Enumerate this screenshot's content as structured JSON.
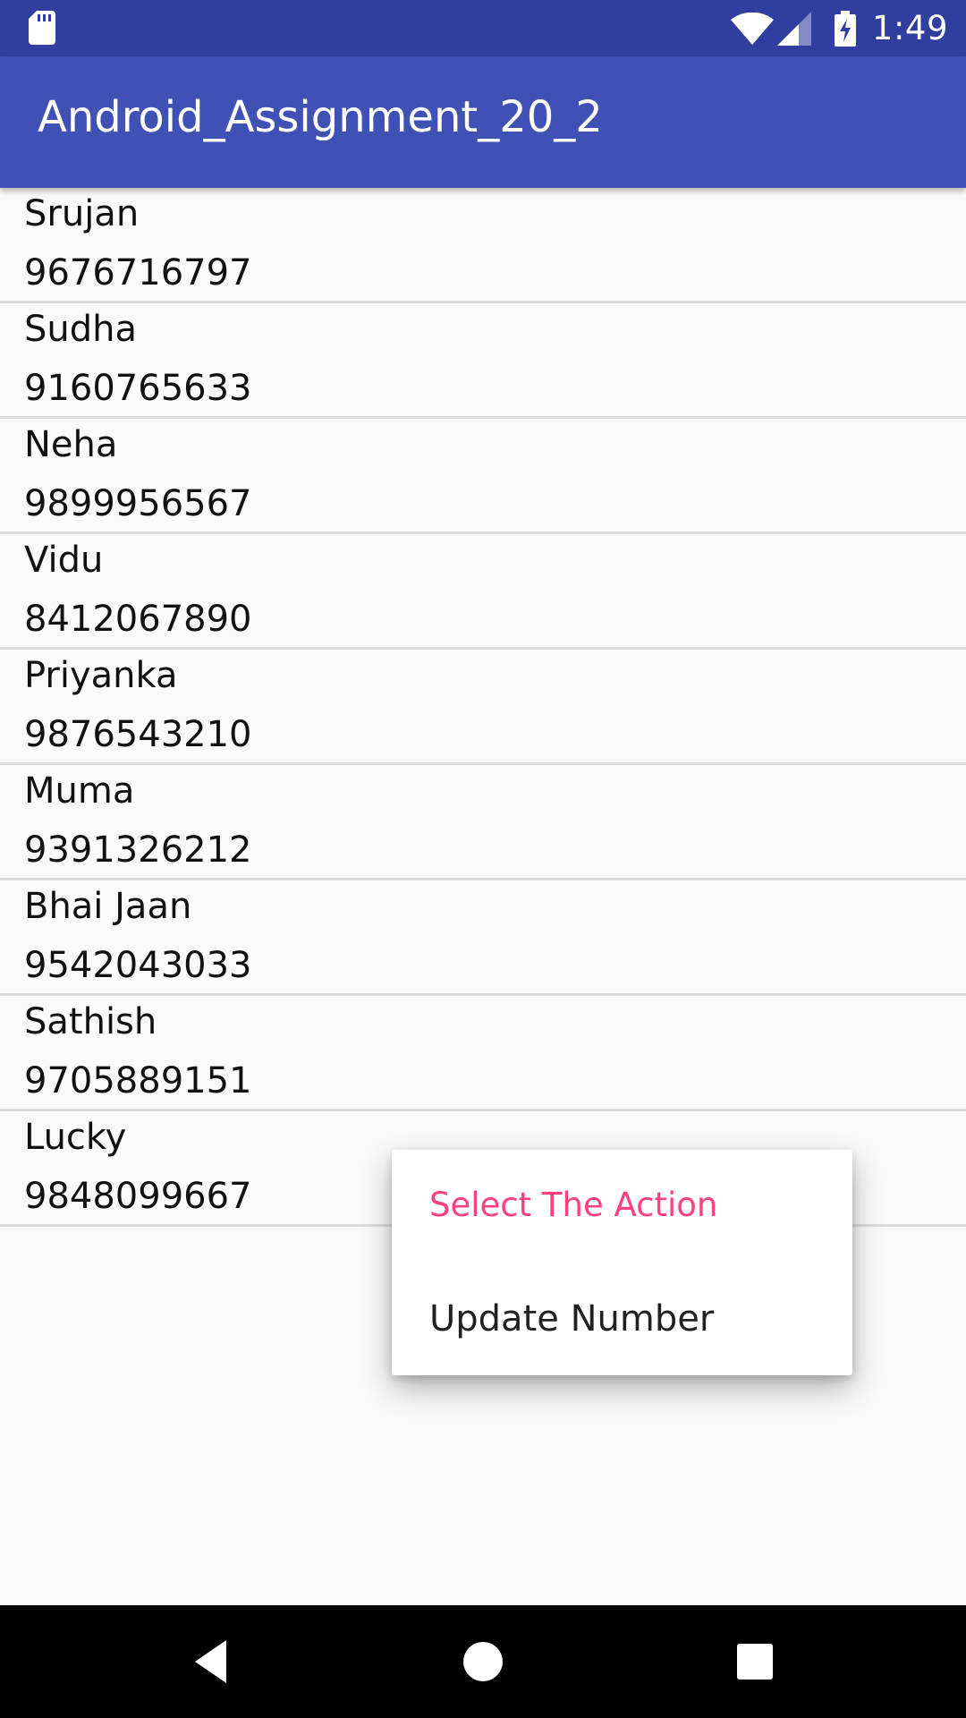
{
  "status_bar": {
    "time": "1:49",
    "icons": [
      "sd-card-icon",
      "wifi-icon",
      "signal-icon",
      "battery-charging-icon"
    ]
  },
  "app_bar": {
    "title": "Android_Assignment_20_2"
  },
  "contacts": [
    {
      "name": "Srujan",
      "number": "9676716797"
    },
    {
      "name": "Sudha",
      "number": "9160765633"
    },
    {
      "name": "Neha",
      "number": "9899956567"
    },
    {
      "name": "Vidu",
      "number": "8412067890"
    },
    {
      "name": "Priyanka",
      "number": "9876543210"
    },
    {
      "name": "Muma",
      "number": "9391326212"
    },
    {
      "name": "Bhai Jaan",
      "number": "9542043033"
    },
    {
      "name": "Sathish",
      "number": "9705889151"
    },
    {
      "name": "Lucky",
      "number": "9848099667"
    }
  ],
  "context_menu": {
    "title": "Select The Action",
    "items": [
      {
        "label": "Update Number"
      }
    ]
  },
  "nav_bar": {
    "icons": [
      "back-icon",
      "home-icon",
      "recents-icon"
    ]
  },
  "colors": {
    "status_bar": "#303f9f",
    "app_bar": "#3f51b5",
    "accent": "#ff4081",
    "background": "#fafafa"
  }
}
